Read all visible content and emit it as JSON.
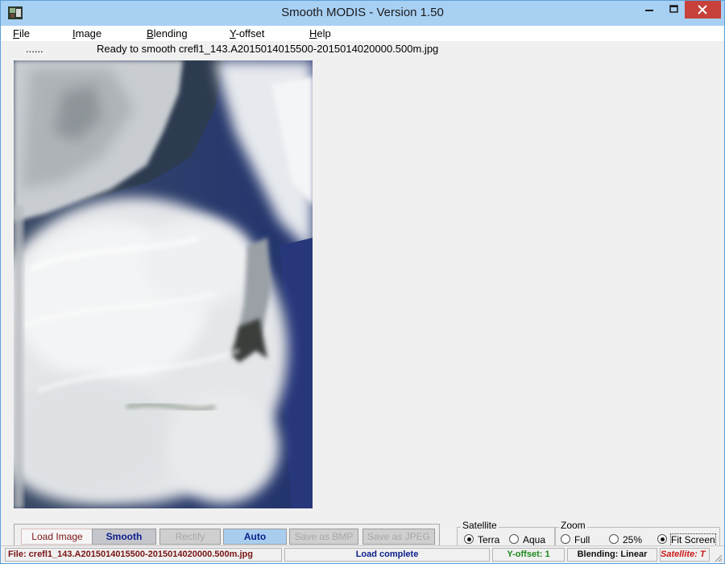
{
  "window": {
    "title": "Smooth MODIS - Version 1.50"
  },
  "menu": {
    "items": [
      {
        "label": "File",
        "mnemonic": "F"
      },
      {
        "label": "Image",
        "mnemonic": "I"
      },
      {
        "label": "Blending",
        "mnemonic": "B"
      },
      {
        "label": "Y-offset",
        "mnemonic": "Y"
      },
      {
        "label": "Help",
        "mnemonic": "H"
      }
    ]
  },
  "status_line": {
    "dots": "......",
    "message": "Ready to smooth crefl1_143.A2015014015500-2015014020000.500m.jpg"
  },
  "buttons": {
    "load_image": "Load Image",
    "smooth": "Smooth",
    "rectify": "Rectify",
    "auto": "Auto",
    "save_bmp": "Save as BMP",
    "save_jpeg": "Save as JPEG"
  },
  "satellite": {
    "legend": "Satellite",
    "options": [
      "Terra",
      "Aqua"
    ],
    "selected": "Terra"
  },
  "zoom": {
    "legend": "Zoom",
    "options": [
      "Full",
      "25%",
      "Fit Screen"
    ],
    "selected": "Fit Screen"
  },
  "statusbar": {
    "file": "File: crefl1_143.A2015014015500-2015014020000.500m.jpg",
    "load": "Load complete",
    "yoffset": "Y-offset: 1",
    "blending": "Blending: Linear",
    "satellite": "Satellite: T"
  },
  "colors": {
    "titlebar": "#a8d0f3",
    "close_button": "#c7413a",
    "accent_blue": "#0b1f8a",
    "status_red": "#7a1414",
    "status_green": "#1c8a1c"
  }
}
